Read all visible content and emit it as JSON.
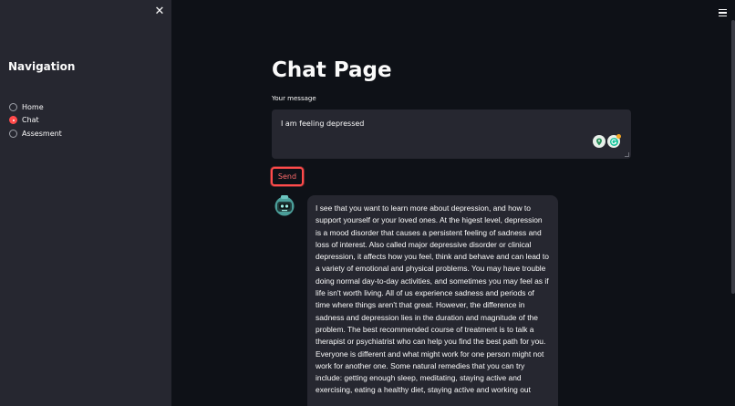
{
  "sidebar": {
    "close_icon": "close-icon",
    "title": "Navigation",
    "options": [
      {
        "label": "Home",
        "selected": false
      },
      {
        "label": "Chat",
        "selected": true
      },
      {
        "label": "Assesment",
        "selected": false
      }
    ]
  },
  "header": {
    "menu_icon": "hamburger-menu-icon"
  },
  "main": {
    "title": "Chat Page",
    "input_label": "Your message",
    "input_value": "I am feeling depressed",
    "send_label": "Send",
    "bot_avatar_icon": "robot-avatar-icon",
    "response": "I see that you want to learn more about depression, and how to support yourself or your loved ones. At the higest level, depression is a mood disorder that causes a persistent feeling of sadness and loss of interest. Also called major depressive disorder or clinical depression, it affects how you feel, think and behave and can lead to a variety of emotional and physical problems. You may have trouble doing normal day-to-day activities, and sometimes you may feel as if life isn't worth living. All of us experience sadness and periods of time where things aren't that great. However, the difference in sadness and depression lies in the duration and magnitude of the problem. The best recommended course of treatment is to talk a therapist or psychiatrist who can help you find the best path for you. Everyone is different and what might work for one person might not work for another one. Some natural remedies that you can try include: getting enough sleep, meditating, staying active and exercising, eating a healthy diet, staying active and working out"
  },
  "colors": {
    "accent": "#ff4b4b",
    "background": "#0e1117",
    "sidebar": "#262730"
  }
}
